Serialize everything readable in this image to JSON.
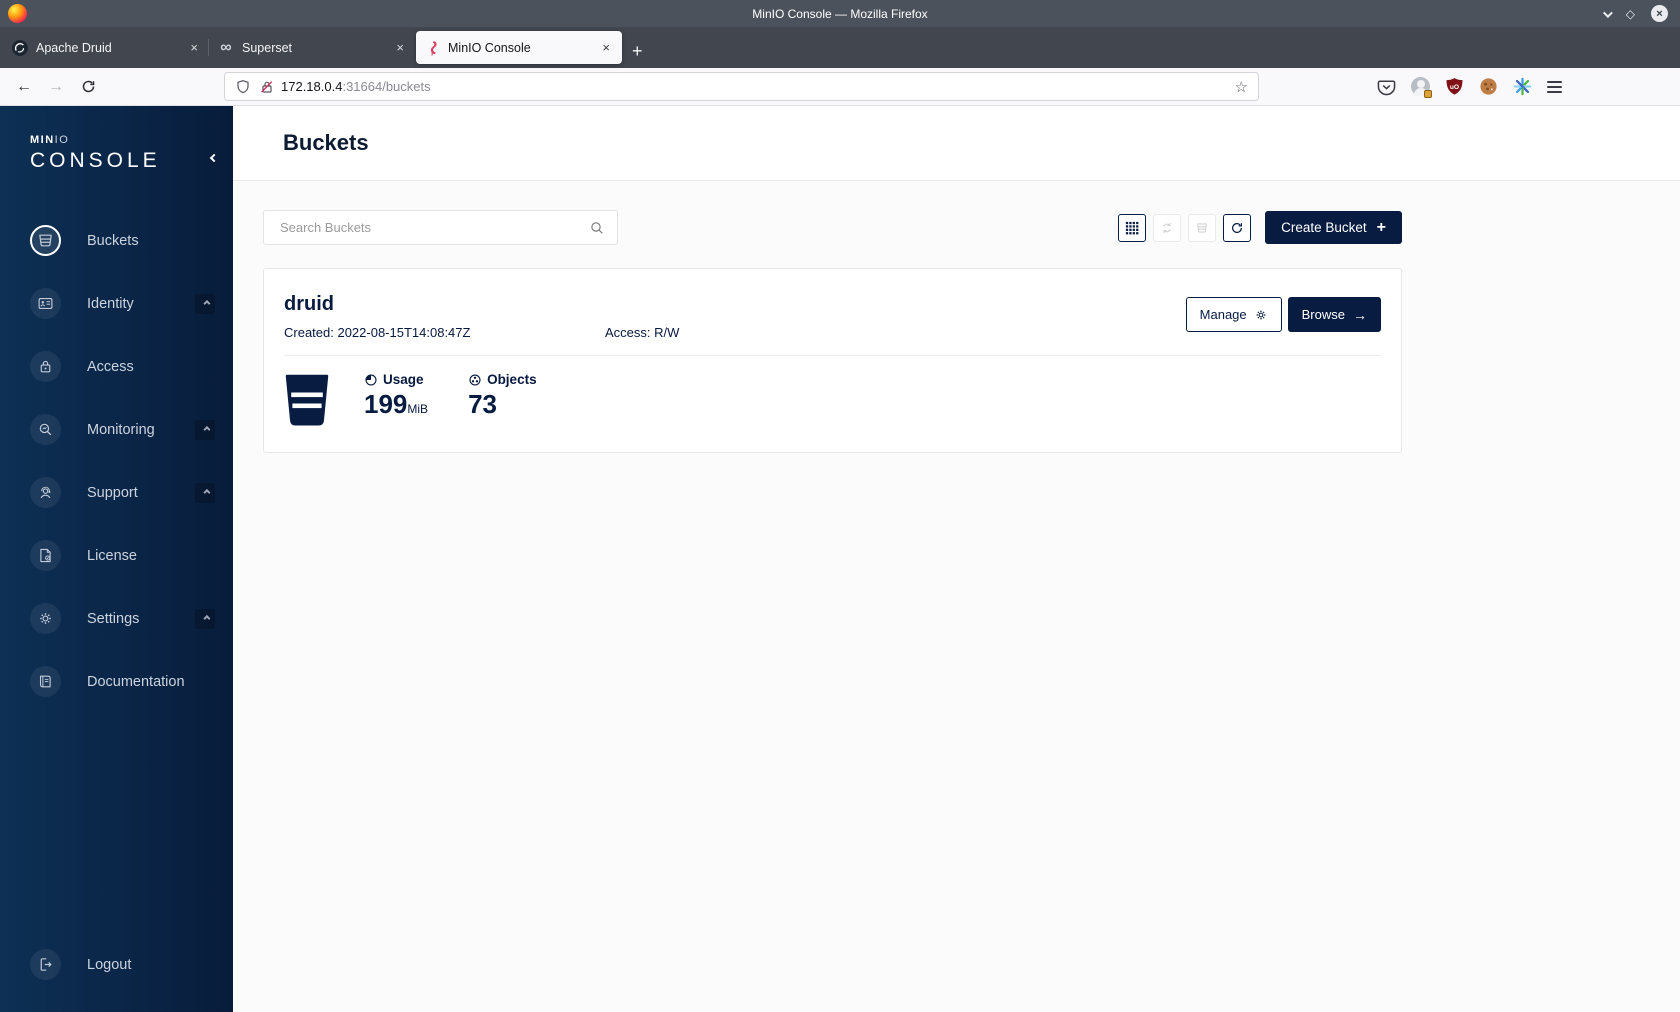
{
  "colors": {
    "navy": "#081C42",
    "flamingo_red": "#dc3a5e",
    "sidebar_left": "#0d3054",
    "sidebar_right": "#081c3a"
  },
  "glyphs": {
    "close": "×",
    "plus": "+",
    "infinity": "∞",
    "star": "☆",
    "back": "←",
    "forward": "→",
    "arrow_right": "→",
    "diamond": "◇"
  },
  "window": {
    "title": "MinIO Console — Mozilla Firefox"
  },
  "tabs": [
    {
      "label": "Apache Druid"
    },
    {
      "label": "Superset"
    },
    {
      "label": "MinIO Console"
    }
  ],
  "toolbar": {
    "url_host": "172.18.0.4",
    "url_rest": ":31664/buckets"
  },
  "sidebar": {
    "logo_brand_bold": "MIN",
    "logo_brand_light": "IO",
    "logo_console": "CONSOLE",
    "items": [
      {
        "label": "Buckets"
      },
      {
        "label": "Identity"
      },
      {
        "label": "Access"
      },
      {
        "label": "Monitoring"
      },
      {
        "label": "Support"
      },
      {
        "label": "License"
      },
      {
        "label": "Settings"
      },
      {
        "label": "Documentation"
      }
    ],
    "logout_label": "Logout"
  },
  "main": {
    "page_title": "Buckets",
    "search_placeholder": "Search Buckets",
    "create_button": "Create Bucket",
    "bucket": {
      "name": "druid",
      "created_label": "Created: 2022-08-15T14:08:47Z",
      "access_label": "Access: R/W",
      "manage_button": "Manage",
      "browse_button": "Browse",
      "usage_label": "Usage",
      "usage_value": "199",
      "usage_unit": "MiB",
      "objects_label": "Objects",
      "objects_value": "73"
    }
  }
}
